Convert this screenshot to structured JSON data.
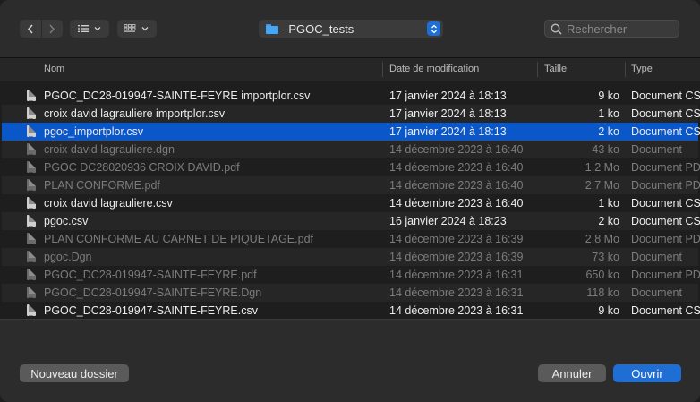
{
  "toolbar": {
    "location": "-PGOC_tests",
    "search_placeholder": "Rechercher"
  },
  "columns": {
    "name": "Nom",
    "date": "Date de modification",
    "size": "Taille",
    "type": "Type"
  },
  "files": [
    {
      "name": "PGOC_DC28-019947-SAINTE-FEYRE importplor.csv",
      "date": "17 janvier 2024 à 18:13",
      "size": "9 ko",
      "type": "Document CSV",
      "enabled": true,
      "selected": false
    },
    {
      "name": "croix david lagrauliere importplor.csv",
      "date": "17 janvier 2024 à 18:13",
      "size": "1 ko",
      "type": "Document CSV",
      "enabled": true,
      "selected": false
    },
    {
      "name": "pgoc_importplor.csv",
      "date": "17 janvier 2024 à 18:13",
      "size": "2 ko",
      "type": "Document CSV",
      "enabled": true,
      "selected": true
    },
    {
      "name": "croix david lagrauliere.dgn",
      "date": "14 décembre 2023 à 16:40",
      "size": "43 ko",
      "type": "Document",
      "enabled": false,
      "selected": false
    },
    {
      "name": "PGOC DC28020936 CROIX DAVID.pdf",
      "date": "14 décembre 2023 à 16:40",
      "size": "1,2 Mo",
      "type": "Document PDF",
      "enabled": false,
      "selected": false
    },
    {
      "name": "PLAN CONFORME.pdf",
      "date": "14 décembre 2023 à 16:40",
      "size": "2,7 Mo",
      "type": "Document PDF",
      "enabled": false,
      "selected": false
    },
    {
      "name": "croix david lagrauliere.csv",
      "date": "14 décembre 2023 à 16:40",
      "size": "1 ko",
      "type": "Document CSV",
      "enabled": true,
      "selected": false
    },
    {
      "name": "pgoc.csv",
      "date": "16 janvier 2024 à 18:23",
      "size": "2 ko",
      "type": "Document CSV",
      "enabled": true,
      "selected": false
    },
    {
      "name": "PLAN CONFORME AU CARNET DE PIQUETAGE.pdf",
      "date": "14 décembre 2023 à 16:39",
      "size": "2,8 Mo",
      "type": "Document PDF",
      "enabled": false,
      "selected": false
    },
    {
      "name": "pgoc.Dgn",
      "date": "14 décembre 2023 à 16:39",
      "size": "73 ko",
      "type": "Document",
      "enabled": false,
      "selected": false
    },
    {
      "name": "PGOC_DC28-019947-SAINTE-FEYRE.pdf",
      "date": "14 décembre 2023 à 16:31",
      "size": "650 ko",
      "type": "Document PDF",
      "enabled": false,
      "selected": false
    },
    {
      "name": "PGOC_DC28-019947-SAINTE-FEYRE.Dgn",
      "date": "14 décembre 2023 à 16:31",
      "size": "118 ko",
      "type": "Document",
      "enabled": false,
      "selected": false
    },
    {
      "name": "PGOC_DC28-019947-SAINTE-FEYRE.csv",
      "date": "14 décembre 2023 à 16:31",
      "size": "9 ko",
      "type": "Document CSV",
      "enabled": true,
      "selected": false
    }
  ],
  "footer": {
    "new_folder_label": "Nouveau dossier",
    "cancel_label": "Annuler",
    "open_label": "Ouvrir"
  },
  "colors": {
    "accent": "#1f6ed4",
    "selection": "#0a57c9",
    "folder": "#49a6f5"
  },
  "icons": {
    "back": "chevron-left-icon",
    "forward": "chevron-right-icon",
    "list_view": "list-view-icon",
    "grid_view": "grid-view-icon",
    "folder": "folder-icon",
    "stepper": "up-down-stepper-icon",
    "search": "search-icon",
    "file": "document-icon"
  }
}
